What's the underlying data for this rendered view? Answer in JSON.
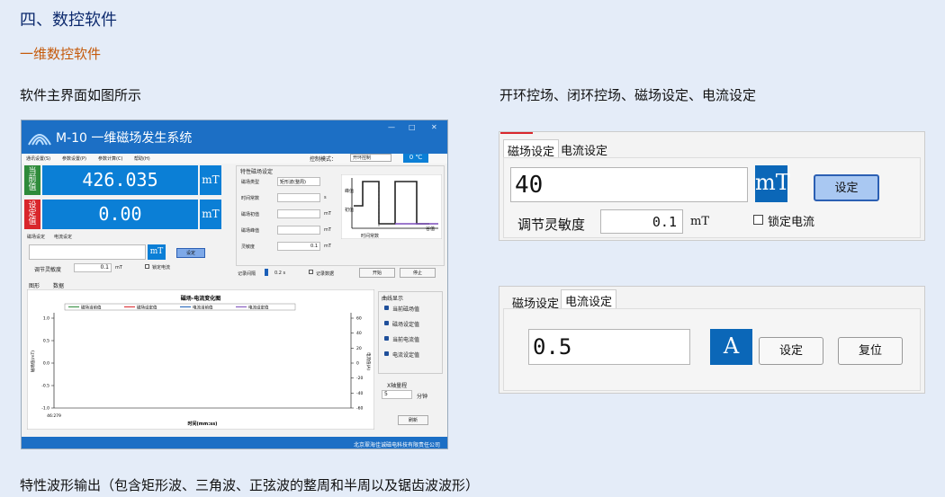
{
  "headings": {
    "section": "四、数控软件",
    "subsection": "一维数控软件",
    "left_caption": "软件主界面如图所示",
    "right_caption": "开环控场、闭环控场、磁场设定、电流设定",
    "bottom_caption": "特性波形输出（包含矩形波、三角波、正弦波的整周和半周以及锯齿波波形）"
  },
  "main_window": {
    "title": "M-10 一维磁场发生系统",
    "menu": [
      "通讯设置(S)",
      "参数设置(P)",
      "参数计算(C)",
      "帮助(H)"
    ],
    "control_mode_label": "控制模式：",
    "control_mode_value": "开环控制",
    "temperature": "0 ℃",
    "current_field_label": "当前值",
    "current_field_value": "426.035",
    "set_value_label": "设定值",
    "set_value": "0.00",
    "unit": "mT",
    "tabs": [
      "磁场设定",
      "电流设定"
    ],
    "small_unit": "mT",
    "set_button": "设定",
    "sensitivity_label": "调节灵敏度",
    "sensitivity_value": "0.1",
    "sensitivity_unit": "mT",
    "lock_current": "锁定电流",
    "char_title": "特性磁场设定",
    "char_fields": [
      {
        "label": "磁场类型",
        "value": "矩形波(整周)",
        "unit": ""
      },
      {
        "label": "时间常数",
        "value": "",
        "unit": "s"
      },
      {
        "label": "磁场初值",
        "value": "",
        "unit": "mT"
      },
      {
        "label": "磁场峰值",
        "value": "",
        "unit": "mT"
      },
      {
        "label": "灵敏度",
        "value": "0.1",
        "unit": "mT"
      }
    ],
    "wave_labels": {
      "peak": "峰值",
      "initial": "初值",
      "valley": "谷值",
      "time_const": "时间常数"
    },
    "record_interval_label": "记录间隔",
    "record_interval_value": "0.2 s",
    "record_data": "记录数据",
    "start_button": "开始",
    "stop_button": "停止",
    "graph_tabs": [
      "图形",
      "数据"
    ],
    "chart_title": "磁场-电流变化图",
    "legend": [
      "磁场当前值",
      "磁场设定值",
      "电流当前值",
      "电流设定值"
    ],
    "curve_title": "曲线显示",
    "curve_items": [
      "当前磁场值",
      "磁场设定值",
      "当前电流值",
      "电流设定值"
    ],
    "x_range_label": "X轴量程",
    "x_range_value": "5",
    "x_range_unit": "分钟",
    "refresh_button": "刷新",
    "y_left_label": "磁场值(mT)",
    "y_right_label": "电流值(A)",
    "x_label": "时间(mm:ss)",
    "x_tick": "46:279",
    "left_ticks": [
      "1.0",
      "0.5",
      "0.0",
      "-0.5",
      "-1.0"
    ],
    "right_ticks": [
      "60",
      "40",
      "20",
      "0",
      "-20",
      "-40",
      "-60"
    ],
    "footer": "北京翠海佳诚磁电科技有限责任公司"
  },
  "field_panel": {
    "tabs": [
      "磁场设定",
      "电流设定"
    ],
    "value": "40",
    "unit": "mT",
    "set_button": "设定",
    "sensitivity_label": "调节灵敏度",
    "sensitivity_value": "0.1",
    "sensitivity_unit": "mT",
    "lock_current": "锁定电流"
  },
  "current_panel": {
    "tabs": [
      "磁场设定",
      "电流设定"
    ],
    "value": "0.5",
    "unit": "A",
    "set_button": "设定",
    "reset_button": "复位"
  },
  "colors": {
    "brand_blue": "#1c6fc5",
    "value_blue": "#0b7fd6",
    "current_green": "#2e8b3a",
    "set_red": "#d9262b",
    "heading_blue": "#0d2a6e",
    "sub_orange": "#c55a0b"
  }
}
